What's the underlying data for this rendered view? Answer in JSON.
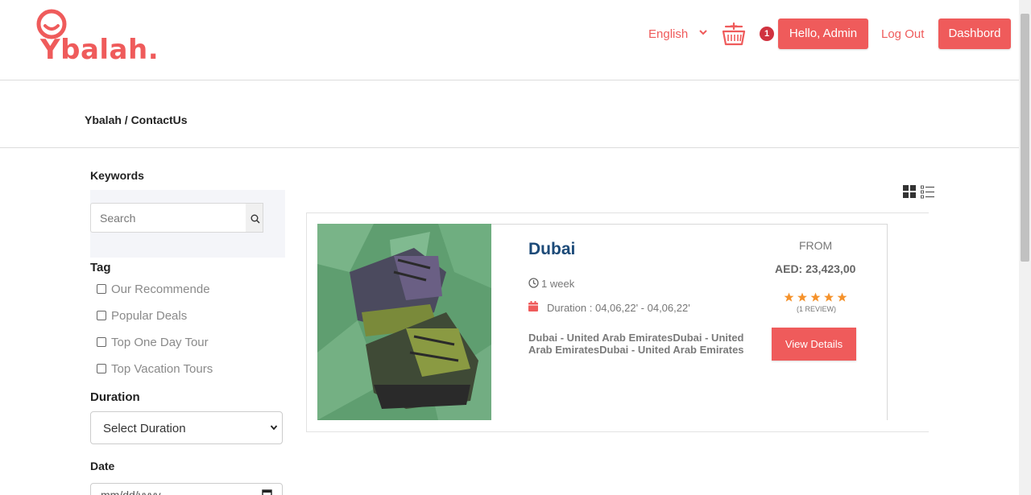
{
  "header": {
    "logo_text": "Ybalah.",
    "language": "English",
    "cart_count": "1",
    "hello_label": "Hello, Admin",
    "logout_label": "Log Out",
    "dashboard_label": "Dashbord"
  },
  "breadcrumb": "Ybalah / ContactUs",
  "sidebar": {
    "keywords_label": "Keywords",
    "search_placeholder": "Search",
    "tag_label": "Tag",
    "tags": [
      "Our Recommende",
      "Popular Deals",
      "Top One Day Tour",
      "Top Vacation Tours"
    ],
    "duration_label": "Duration",
    "duration_value": "Select Duration",
    "date_label": "Date",
    "date_placeholder": "mm/dd/yyyy"
  },
  "listing": {
    "title": "Dubai",
    "length": "1 week",
    "duration": "Duration : 04,06,22' - 04,06,22'",
    "location": "Dubai - United Arab EmiratesDubai - United Arab EmiratesDubai - United Arab Emirates",
    "from_label": "FROM",
    "price": "AED: 23,423,00",
    "rating": 5,
    "reviews": "(1 REVIEW)",
    "details_label": "View Details"
  },
  "colors": {
    "accent": "#ef5b5b",
    "title": "#1c4a78",
    "star": "#f5922b"
  }
}
